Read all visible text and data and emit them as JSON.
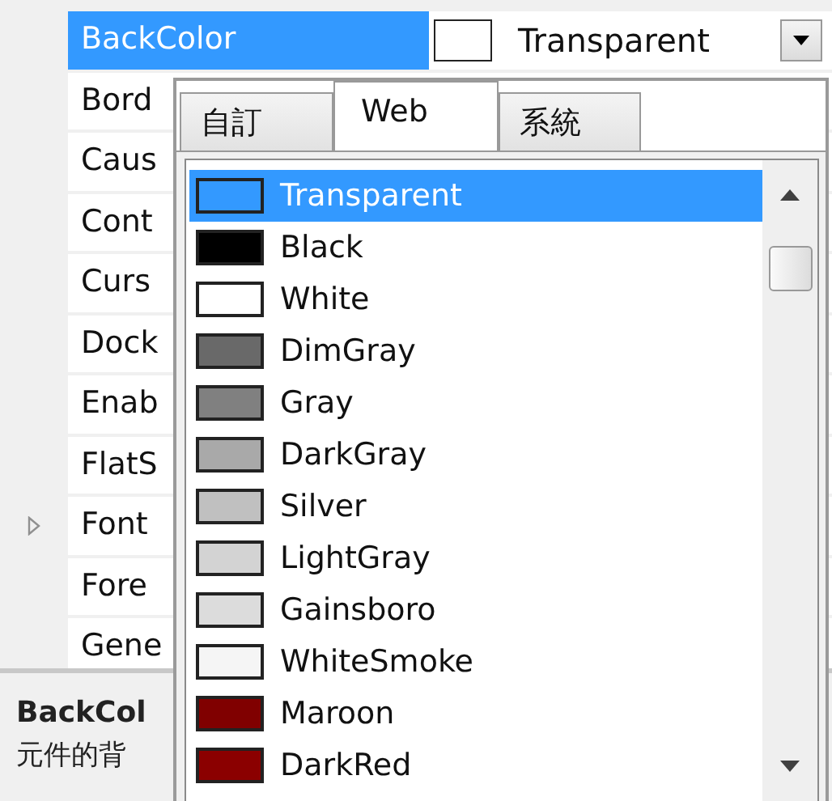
{
  "property_grid": {
    "rows": [
      {
        "name": "BackColor",
        "selected": true,
        "expandable": false,
        "value": "Transparent"
      },
      {
        "name": "Bord",
        "selected": false,
        "expandable": false
      },
      {
        "name": "Caus",
        "selected": false,
        "expandable": false
      },
      {
        "name": "Cont",
        "selected": false,
        "expandable": false
      },
      {
        "name": "Curs",
        "selected": false,
        "expandable": false
      },
      {
        "name": "Dock",
        "selected": false,
        "expandable": false
      },
      {
        "name": "Enab",
        "selected": false,
        "expandable": false
      },
      {
        "name": "FlatS",
        "selected": false,
        "expandable": false
      },
      {
        "name": "Font",
        "selected": false,
        "expandable": true
      },
      {
        "name": "Fore",
        "selected": false,
        "expandable": false
      },
      {
        "name": "Gene",
        "selected": false,
        "expandable": false
      }
    ]
  },
  "description": {
    "title": "BackCol",
    "text": "元件的背"
  },
  "color_picker": {
    "tabs": [
      {
        "label": "自訂",
        "selected": false
      },
      {
        "label": "Web",
        "selected": true
      },
      {
        "label": "系統",
        "selected": false
      }
    ],
    "colors": [
      {
        "name": "Transparent",
        "color": "#3399ff",
        "selected": true
      },
      {
        "name": "Black",
        "color": "#000000",
        "selected": false
      },
      {
        "name": "White",
        "color": "#ffffff",
        "selected": false
      },
      {
        "name": "DimGray",
        "color": "#696969",
        "selected": false
      },
      {
        "name": "Gray",
        "color": "#808080",
        "selected": false
      },
      {
        "name": "DarkGray",
        "color": "#a9a9a9",
        "selected": false
      },
      {
        "name": "Silver",
        "color": "#c0c0c0",
        "selected": false
      },
      {
        "name": "LightGray",
        "color": "#d3d3d3",
        "selected": false
      },
      {
        "name": "Gainsboro",
        "color": "#dcdcdc",
        "selected": false
      },
      {
        "name": "WhiteSmoke",
        "color": "#f5f5f5",
        "selected": false
      },
      {
        "name": "Maroon",
        "color": "#800000",
        "selected": false
      },
      {
        "name": "DarkRed",
        "color": "#8b0000",
        "selected": false
      }
    ]
  }
}
